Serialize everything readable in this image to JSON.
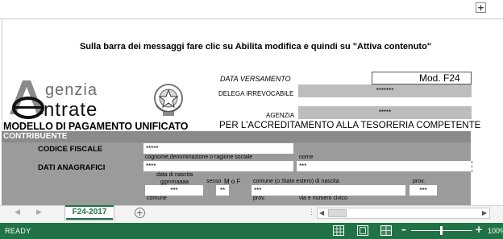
{
  "toolbar": {
    "expand_icon": "plus-icon",
    "expand_label": "+"
  },
  "notice": "Sulla barra dei messaggi fare clic su Abilita modifica  e quindi su \"Attiva contenuto\"",
  "logo": {
    "line1": "genzia",
    "line2": "ntrate"
  },
  "header": {
    "data_versamento_label": "DATA VERSAMENTO",
    "mod_label": "Mod. F24",
    "delega_label": "DELEGA IRREVOCABILE",
    "delega_value": "*******",
    "agenzia_label": "AGENZIA",
    "agenzia_value": "*****",
    "modello_title": "MODELLO DI PAGAMENTO UNIFICATO",
    "accredito": "PER L'ACCREDITAMENTO ALLA TESORERIA COMPETENTE"
  },
  "contribuente": {
    "section_label": "CONTRIBUENTE",
    "codice_fiscale_label": "CODICE FISCALE",
    "codice_fiscale_value": "*****",
    "cognome_label": "cognome,denominazione o ragione sociale",
    "nome_label": "nome",
    "dati_anagrafici_label": "DATI ANAGRAFICI",
    "cognome_value": "****",
    "nome_value": "***",
    "data_nascita_label": "data di nascita",
    "data_format_label": "ggmmaaaa",
    "sesso_label": "sesso",
    "mof_label": "M o F",
    "comune_nascita_label": "comune (o Stato estero) di nascita",
    "prov_label": "prov.",
    "data_nascita_value": "***",
    "sesso_value": "**",
    "comune_nascita_value": "***",
    "prov_value": "***",
    "comune_label": "comune",
    "prov2_label": "prov.",
    "via_label": "via e numero civico"
  },
  "tabs": {
    "sheet_name": "F24-2017",
    "add_label": "+",
    "nav_prev": "◀",
    "nav_next": "▶",
    "dots": "⋮",
    "scroll_left": "◀",
    "scroll_right": "▶"
  },
  "status": {
    "ready": "READY",
    "zoom_minus": "–",
    "zoom_plus": "+",
    "zoom_value": "100%",
    "zoom_level": 100
  },
  "colors": {
    "excel_green": "#217346",
    "form_gray": "#9b9b9b"
  }
}
